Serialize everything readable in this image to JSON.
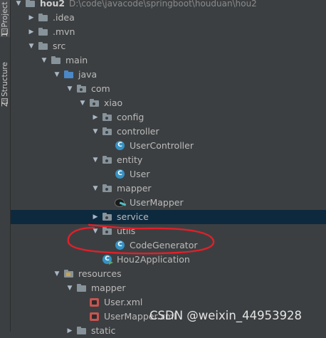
{
  "side_tabs": [
    {
      "label": "1: Project"
    },
    {
      "label": "Z: Structure"
    }
  ],
  "tree": [
    {
      "name": "hou2",
      "path": "D:\\code\\javacode\\springboot\\houduan\\hou2",
      "icon": "module-folder-icon",
      "depth": 0,
      "expanded": true,
      "bold": true
    },
    {
      "name": ".idea",
      "icon": "folder-icon",
      "depth": 1,
      "expanded": false
    },
    {
      "name": ".mvn",
      "icon": "folder-icon",
      "depth": 1,
      "expanded": false
    },
    {
      "name": "src",
      "icon": "folder-icon",
      "depth": 1,
      "expanded": true
    },
    {
      "name": "main",
      "icon": "folder-icon",
      "depth": 2,
      "expanded": true
    },
    {
      "name": "java",
      "icon": "source-folder-icon",
      "depth": 3,
      "expanded": true
    },
    {
      "name": "com",
      "icon": "package-icon",
      "depth": 4,
      "expanded": true
    },
    {
      "name": "xiao",
      "icon": "package-icon",
      "depth": 5,
      "expanded": true
    },
    {
      "name": "config",
      "icon": "package-icon",
      "depth": 6,
      "expanded": false
    },
    {
      "name": "controller",
      "icon": "package-icon",
      "depth": 6,
      "expanded": true
    },
    {
      "name": "UserController",
      "icon": "class-icon",
      "depth": 7
    },
    {
      "name": "entity",
      "icon": "package-icon",
      "depth": 6,
      "expanded": true
    },
    {
      "name": "User",
      "icon": "class-icon",
      "depth": 7
    },
    {
      "name": "mapper",
      "icon": "package-icon",
      "depth": 6,
      "expanded": true
    },
    {
      "name": "UserMapper",
      "icon": "mybatis-mapper-icon",
      "depth": 7
    },
    {
      "name": "service",
      "icon": "package-icon",
      "depth": 6,
      "expanded": false,
      "selected": true
    },
    {
      "name": "utils",
      "icon": "package-icon",
      "depth": 6,
      "expanded": true
    },
    {
      "name": "CodeGenerator",
      "icon": "class-icon",
      "depth": 7
    },
    {
      "name": "Hou2Application",
      "icon": "spring-boot-class-icon",
      "depth": 6
    },
    {
      "name": "resources",
      "icon": "resources-folder-icon",
      "depth": 3,
      "expanded": true
    },
    {
      "name": "mapper",
      "icon": "folder-icon",
      "depth": 4,
      "expanded": true
    },
    {
      "name": "User.xml",
      "icon": "xml-file-icon",
      "depth": 5
    },
    {
      "name": "UserMapper.xml",
      "icon": "xml-file-icon",
      "depth": 5
    },
    {
      "name": "static",
      "icon": "folder-icon",
      "depth": 4,
      "expanded": false
    }
  ],
  "colors": {
    "background": "#3c3f41",
    "selection": "#0d293e",
    "annotation": "#e0202a"
  },
  "watermark": "CSDN @weixin_44953928"
}
